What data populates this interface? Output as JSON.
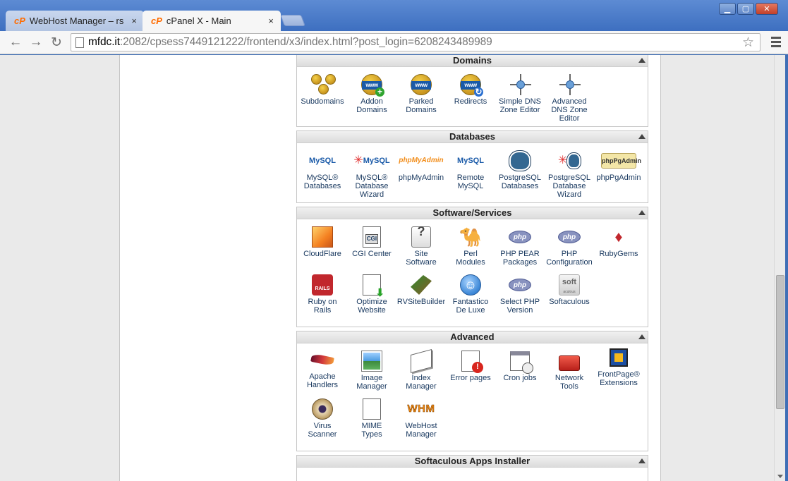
{
  "browser": {
    "tabs": [
      {
        "label": "WebHost Manager – rs",
        "active": false
      },
      {
        "label": "cPanel X - Main",
        "active": true
      }
    ],
    "tab_icon_text": "cP",
    "tab_close": "×",
    "url_host": "mfdc.it",
    "url_rest": ":2082/cpsess7449121222/frontend/x3/index.html?post_login=6208243489989"
  },
  "panels": {
    "domains": {
      "title": "Domains",
      "items": [
        {
          "label": "Subdomains",
          "icon": "subdomains-icon"
        },
        {
          "label": "Addon\nDomains",
          "icon": "addon-domains-icon"
        },
        {
          "label": "Parked\nDomains",
          "icon": "parked-domains-icon"
        },
        {
          "label": "Redirects",
          "icon": "redirects-icon"
        },
        {
          "label": "Simple DNS\nZone Editor",
          "icon": "dns-icon"
        },
        {
          "label": "Advanced\nDNS Zone\nEditor",
          "icon": "dns-icon"
        }
      ]
    },
    "databases": {
      "title": "Databases",
      "items": [
        {
          "label": "MySQL®\nDatabases",
          "icon": "mysql-icon"
        },
        {
          "label": "MySQL®\nDatabase\nWizard",
          "icon": "mysql-wizard-icon"
        },
        {
          "label": "phpMyAdmin",
          "icon": "phpmyadmin-icon"
        },
        {
          "label": "Remote\nMySQL",
          "icon": "remote-mysql-icon"
        },
        {
          "label": "PostgreSQL\nDatabases",
          "icon": "postgresql-icon"
        },
        {
          "label": "PostgreSQL\nDatabase\nWizard",
          "icon": "postgresql-wizard-icon"
        },
        {
          "label": "phpPgAdmin",
          "icon": "phppgadmin-icon"
        }
      ],
      "mysql_logo": "MySQL",
      "pma_logo": "phpMyAdmin",
      "pgadmin_logo": "phpPgAdmin"
    },
    "software": {
      "title": "Software/Services",
      "items": [
        {
          "label": "CloudFlare",
          "icon": "cloudflare-icon"
        },
        {
          "label": "CGI Center",
          "icon": "cgi-icon"
        },
        {
          "label": "Site\nSoftware",
          "icon": "site-software-icon"
        },
        {
          "label": "Perl\nModules",
          "icon": "perl-icon"
        },
        {
          "label": "PHP PEAR\nPackages",
          "icon": "php-pear-icon"
        },
        {
          "label": "PHP\nConfiguration",
          "icon": "php-config-icon"
        },
        {
          "label": "RubyGems",
          "icon": "rubygems-icon"
        },
        {
          "label": "Ruby on\nRails",
          "icon": "rails-icon"
        },
        {
          "label": "Optimize\nWebsite",
          "icon": "optimize-icon"
        },
        {
          "label": "RVSiteBuilder",
          "icon": "rvsitebuilder-icon"
        },
        {
          "label": "Fantastico\nDe Luxe",
          "icon": "fantastico-icon"
        },
        {
          "label": "Select PHP\nVersion",
          "icon": "select-php-icon"
        },
        {
          "label": "Softaculous",
          "icon": "softaculous-icon"
        }
      ],
      "php_logo": "php",
      "cgi_logo": "CGI",
      "rails_logo": "RAILS",
      "soft_logo": "soft",
      "soft_sub": "aculous"
    },
    "advanced": {
      "title": "Advanced",
      "items": [
        {
          "label": "Apache\nHandlers",
          "icon": "apache-icon"
        },
        {
          "label": "Image\nManager",
          "icon": "image-icon"
        },
        {
          "label": "Index\nManager",
          "icon": "index-icon"
        },
        {
          "label": "Error pages",
          "icon": "error-pages-icon"
        },
        {
          "label": "Cron jobs",
          "icon": "cron-icon"
        },
        {
          "label": "Network\nTools",
          "icon": "network-tools-icon"
        },
        {
          "label": "FrontPage®\nExtensions",
          "icon": "frontpage-icon"
        },
        {
          "label": "Virus\nScanner",
          "icon": "virus-icon"
        },
        {
          "label": "MIME\nTypes",
          "icon": "mime-icon"
        },
        {
          "label": "WebHost\nManager",
          "icon": "whm-icon"
        }
      ],
      "whm_logo": "WHM"
    },
    "softaculous": {
      "title": "Softaculous Apps Installer"
    }
  },
  "www_text": "www"
}
